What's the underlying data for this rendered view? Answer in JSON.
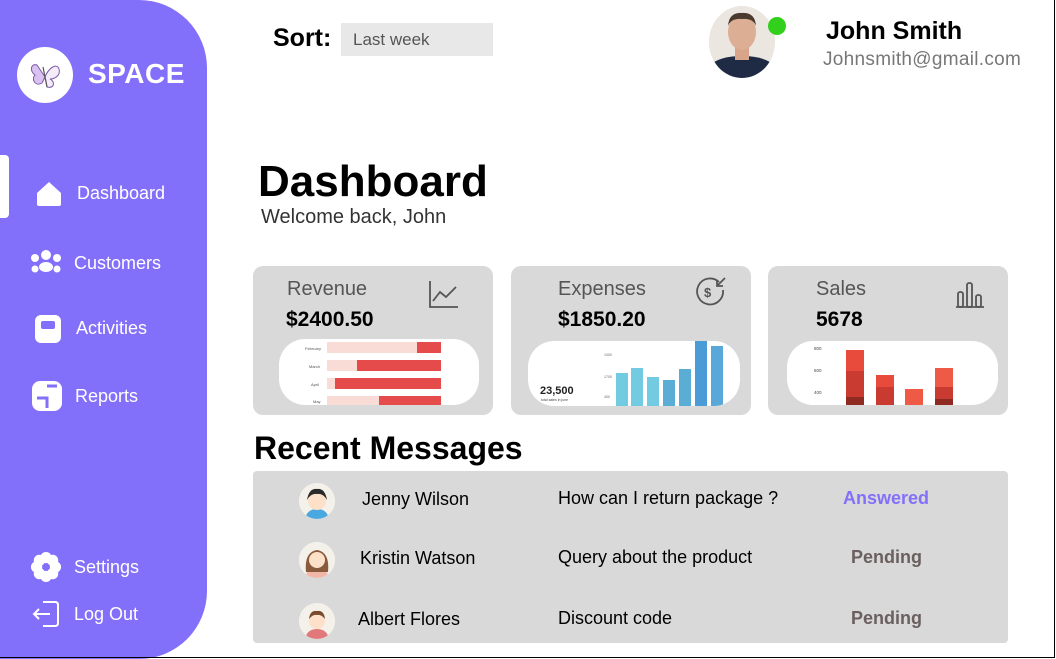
{
  "sidebar": {
    "brand": "SPACE",
    "accent_color": "#8270fb",
    "nav": [
      {
        "label": "Dashboard",
        "icon": "home-icon",
        "active": true
      },
      {
        "label": "Customers",
        "icon": "users-icon"
      },
      {
        "label": "Activities",
        "icon": "clipboard-icon"
      },
      {
        "label": "Reports",
        "icon": "report-icon"
      }
    ],
    "bottom": [
      {
        "label": "Settings",
        "icon": "gear-icon"
      },
      {
        "label": "Log Out",
        "icon": "logout-icon"
      }
    ]
  },
  "header": {
    "sort_label": "Sort:",
    "sort_value": "Last week",
    "user_name": "John Smith",
    "user_email": "Johnsmith@gmail.com",
    "online_color": "#32d01c"
  },
  "page": {
    "title": "Dashboard",
    "welcome": "Welcome back, John"
  },
  "cards": [
    {
      "label": "Revenue",
      "value": "$2400.50",
      "icon": "line-chart-icon"
    },
    {
      "label": "Expenses",
      "value": "$1850.20",
      "icon": "dollar-arrow-icon"
    },
    {
      "label": "Sales",
      "value": "5678",
      "icon": "bar-chart-icon"
    }
  ],
  "mini_charts": {
    "revenue": {
      "categories": [
        "February",
        "March",
        "April",
        "May"
      ]
    },
    "expenses": {
      "headline": "23,500",
      "caption": "total sales in june",
      "ticks": [
        "1000",
        "1700",
        "400"
      ]
    },
    "sales": {
      "ticks": [
        "800",
        "600",
        "400"
      ]
    }
  },
  "messages": {
    "title": "Recent Messages",
    "rows": [
      {
        "name": "Jenny Wilson",
        "subject": "How can I return package ?",
        "status": "Answered",
        "status_color": "#8270fb"
      },
      {
        "name": "Kristin Watson",
        "subject": "Query about the product",
        "status": "Pending",
        "status_color": "#6b5f5f"
      },
      {
        "name": "Albert Flores",
        "subject": "Discount code",
        "status": "Pending",
        "status_color": "#6b5f5f"
      }
    ]
  }
}
